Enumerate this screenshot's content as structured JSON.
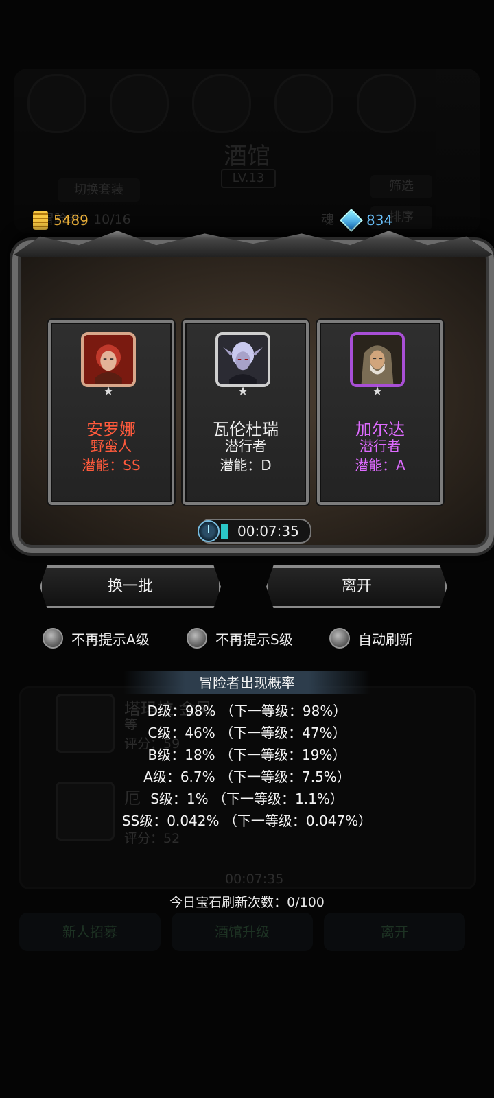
{
  "background": {
    "title": "酒馆",
    "level": "LV.13",
    "switch_outfit": "切换套装",
    "filter": "筛选",
    "sort": "排序",
    "adventurer_count": "冒险者：10/16",
    "soul_label": "魂",
    "list_items": [
      {
        "name": "塔玛拉·金凤",
        "line2": "等",
        "score": "评分：59"
      },
      {
        "name": "厄",
        "score": "评分：52"
      }
    ],
    "timer": "00:07:35",
    "bottom_buttons": [
      "新人招募",
      "酒馆升级",
      "离开"
    ]
  },
  "currency": {
    "gold": "5489",
    "gems": "834"
  },
  "heroes": [
    {
      "name": "安罗娜",
      "class": "野蛮人",
      "potential": "潜能：SS",
      "rarity": "ss",
      "portrait": "red-hair-woman-portrait"
    },
    {
      "name": "瓦伦杜瑞",
      "class": "潜行者",
      "potential": "潜能：D",
      "rarity": "d",
      "portrait": "pale-elf-portrait"
    },
    {
      "name": "加尔达",
      "class": "潜行者",
      "potential": "潜能：A",
      "rarity": "a",
      "portrait": "hooded-old-man-portrait"
    }
  ],
  "rarity_colors": {
    "ss": "#ff5a3c",
    "d": "#f0f0f0",
    "a": "#de6bff"
  },
  "timer": "00:07:35",
  "buttons": {
    "refresh": "换一批",
    "leave": "离开"
  },
  "options": [
    {
      "label": "不再提示A级"
    },
    {
      "label": "不再提示S级"
    },
    {
      "label": "自动刷新"
    }
  ],
  "probability": {
    "title": "冒险者出现概率",
    "lines": [
      "D级：98% （下一等级：98%）",
      "C级：46% （下一等级：47%）",
      "B级：18% （下一等级：19%）",
      "A级：6.7% （下一等级：7.5%）",
      "S级：1% （下一等级：1.1%）",
      "SS级：0.042% （下一等级：0.047%）"
    ]
  },
  "gem_refresh": "今日宝石刷新次数：0/100"
}
